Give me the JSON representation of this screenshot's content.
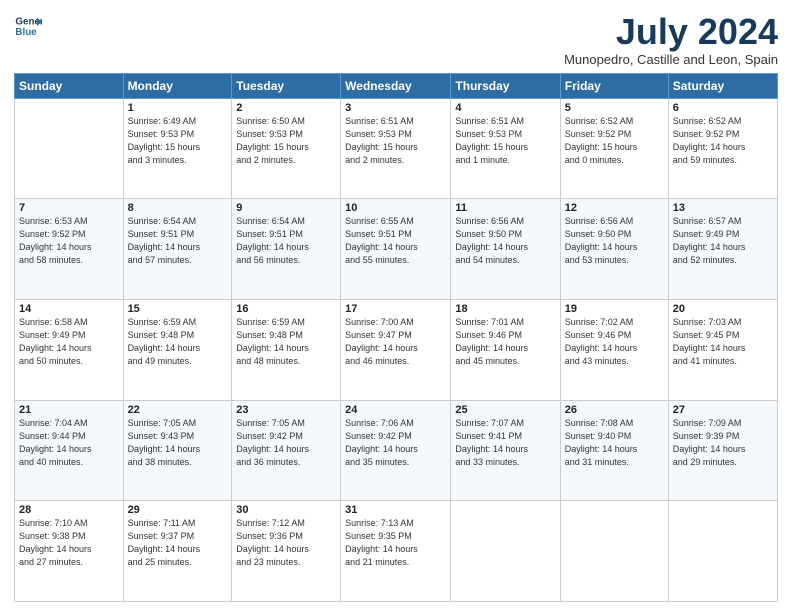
{
  "header": {
    "logo_line1": "General",
    "logo_line2": "Blue",
    "main_title": "July 2024",
    "subtitle": "Munopedro, Castille and Leon, Spain"
  },
  "days_of_week": [
    "Sunday",
    "Monday",
    "Tuesday",
    "Wednesday",
    "Thursday",
    "Friday",
    "Saturday"
  ],
  "weeks": [
    [
      {
        "day": "",
        "info": ""
      },
      {
        "day": "1",
        "info": "Sunrise: 6:49 AM\nSunset: 9:53 PM\nDaylight: 15 hours\nand 3 minutes."
      },
      {
        "day": "2",
        "info": "Sunrise: 6:50 AM\nSunset: 9:53 PM\nDaylight: 15 hours\nand 2 minutes."
      },
      {
        "day": "3",
        "info": "Sunrise: 6:51 AM\nSunset: 9:53 PM\nDaylight: 15 hours\nand 2 minutes."
      },
      {
        "day": "4",
        "info": "Sunrise: 6:51 AM\nSunset: 9:53 PM\nDaylight: 15 hours\nand 1 minute."
      },
      {
        "day": "5",
        "info": "Sunrise: 6:52 AM\nSunset: 9:52 PM\nDaylight: 15 hours\nand 0 minutes."
      },
      {
        "day": "6",
        "info": "Sunrise: 6:52 AM\nSunset: 9:52 PM\nDaylight: 14 hours\nand 59 minutes."
      }
    ],
    [
      {
        "day": "7",
        "info": "Sunrise: 6:53 AM\nSunset: 9:52 PM\nDaylight: 14 hours\nand 58 minutes."
      },
      {
        "day": "8",
        "info": "Sunrise: 6:54 AM\nSunset: 9:51 PM\nDaylight: 14 hours\nand 57 minutes."
      },
      {
        "day": "9",
        "info": "Sunrise: 6:54 AM\nSunset: 9:51 PM\nDaylight: 14 hours\nand 56 minutes."
      },
      {
        "day": "10",
        "info": "Sunrise: 6:55 AM\nSunset: 9:51 PM\nDaylight: 14 hours\nand 55 minutes."
      },
      {
        "day": "11",
        "info": "Sunrise: 6:56 AM\nSunset: 9:50 PM\nDaylight: 14 hours\nand 54 minutes."
      },
      {
        "day": "12",
        "info": "Sunrise: 6:56 AM\nSunset: 9:50 PM\nDaylight: 14 hours\nand 53 minutes."
      },
      {
        "day": "13",
        "info": "Sunrise: 6:57 AM\nSunset: 9:49 PM\nDaylight: 14 hours\nand 52 minutes."
      }
    ],
    [
      {
        "day": "14",
        "info": "Sunrise: 6:58 AM\nSunset: 9:49 PM\nDaylight: 14 hours\nand 50 minutes."
      },
      {
        "day": "15",
        "info": "Sunrise: 6:59 AM\nSunset: 9:48 PM\nDaylight: 14 hours\nand 49 minutes."
      },
      {
        "day": "16",
        "info": "Sunrise: 6:59 AM\nSunset: 9:48 PM\nDaylight: 14 hours\nand 48 minutes."
      },
      {
        "day": "17",
        "info": "Sunrise: 7:00 AM\nSunset: 9:47 PM\nDaylight: 14 hours\nand 46 minutes."
      },
      {
        "day": "18",
        "info": "Sunrise: 7:01 AM\nSunset: 9:46 PM\nDaylight: 14 hours\nand 45 minutes."
      },
      {
        "day": "19",
        "info": "Sunrise: 7:02 AM\nSunset: 9:46 PM\nDaylight: 14 hours\nand 43 minutes."
      },
      {
        "day": "20",
        "info": "Sunrise: 7:03 AM\nSunset: 9:45 PM\nDaylight: 14 hours\nand 41 minutes."
      }
    ],
    [
      {
        "day": "21",
        "info": "Sunrise: 7:04 AM\nSunset: 9:44 PM\nDaylight: 14 hours\nand 40 minutes."
      },
      {
        "day": "22",
        "info": "Sunrise: 7:05 AM\nSunset: 9:43 PM\nDaylight: 14 hours\nand 38 minutes."
      },
      {
        "day": "23",
        "info": "Sunrise: 7:05 AM\nSunset: 9:42 PM\nDaylight: 14 hours\nand 36 minutes."
      },
      {
        "day": "24",
        "info": "Sunrise: 7:06 AM\nSunset: 9:42 PM\nDaylight: 14 hours\nand 35 minutes."
      },
      {
        "day": "25",
        "info": "Sunrise: 7:07 AM\nSunset: 9:41 PM\nDaylight: 14 hours\nand 33 minutes."
      },
      {
        "day": "26",
        "info": "Sunrise: 7:08 AM\nSunset: 9:40 PM\nDaylight: 14 hours\nand 31 minutes."
      },
      {
        "day": "27",
        "info": "Sunrise: 7:09 AM\nSunset: 9:39 PM\nDaylight: 14 hours\nand 29 minutes."
      }
    ],
    [
      {
        "day": "28",
        "info": "Sunrise: 7:10 AM\nSunset: 9:38 PM\nDaylight: 14 hours\nand 27 minutes."
      },
      {
        "day": "29",
        "info": "Sunrise: 7:11 AM\nSunset: 9:37 PM\nDaylight: 14 hours\nand 25 minutes."
      },
      {
        "day": "30",
        "info": "Sunrise: 7:12 AM\nSunset: 9:36 PM\nDaylight: 14 hours\nand 23 minutes."
      },
      {
        "day": "31",
        "info": "Sunrise: 7:13 AM\nSunset: 9:35 PM\nDaylight: 14 hours\nand 21 minutes."
      },
      {
        "day": "",
        "info": ""
      },
      {
        "day": "",
        "info": ""
      },
      {
        "day": "",
        "info": ""
      }
    ]
  ]
}
